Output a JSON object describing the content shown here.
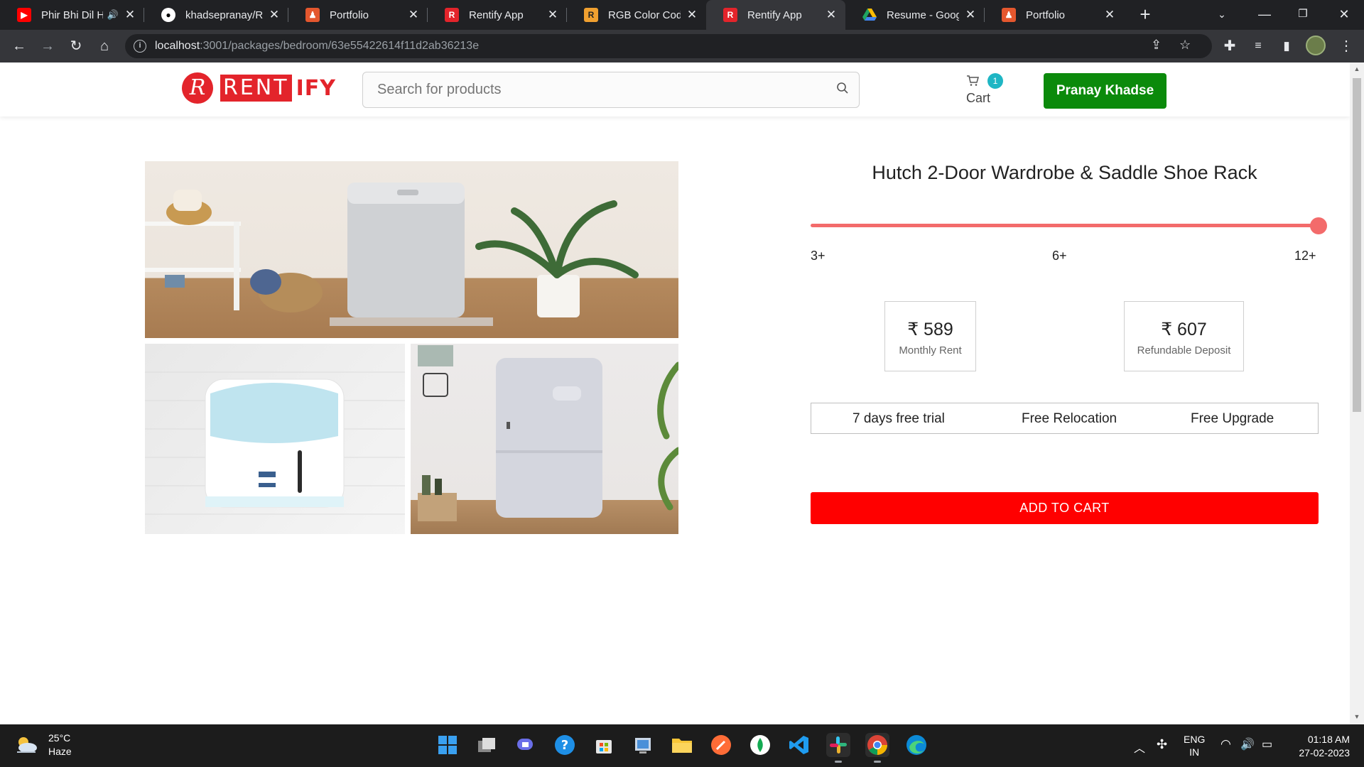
{
  "browser": {
    "tabs": [
      {
        "title": "Phir Bhi Dil H",
        "icon": "youtube-icon",
        "color": "#ff0000",
        "audio": true
      },
      {
        "title": "khadsepranay/Re",
        "icon": "github-icon",
        "color": "#ffffff"
      },
      {
        "title": "Portfolio",
        "icon": "portfolio-icon",
        "color": "#e4572e"
      },
      {
        "title": "Rentify App",
        "icon": "rentify-icon",
        "color": "#e3242b"
      },
      {
        "title": "RGB Color Codes",
        "icon": "rgb-icon",
        "color": "#f0a030"
      },
      {
        "title": "Rentify App",
        "icon": "rentify-icon",
        "color": "#e3242b",
        "active": true
      },
      {
        "title": "Resume - Google",
        "icon": "google-drive-icon",
        "color": "#1fa463"
      },
      {
        "title": "Portfolio",
        "icon": "portfolio-icon",
        "color": "#e4572e"
      }
    ],
    "url_host": "localhost",
    "url_path": ":3001/packages/bedroom/63e55422614f11d2ab36213e"
  },
  "header": {
    "logo_letter": "R",
    "logo_boxed": "RENT",
    "logo_rest": "IFY",
    "search_placeholder": "Search for products",
    "cart_label": "Cart",
    "cart_count": "1",
    "user_name": "Pranay Khadse"
  },
  "product": {
    "title": "Hutch 2-Door Wardrobe & Saddle Shoe Rack",
    "tenure_ticks": [
      "3+",
      "6+",
      "12+"
    ],
    "tenure_selected": "12+",
    "monthly_rent": "₹ 589",
    "monthly_rent_label": "Monthly Rent",
    "deposit": "₹ 607",
    "deposit_label": "Refundable Deposit",
    "features": [
      "7 days free trial",
      "Free Relocation",
      "Free Upgrade"
    ],
    "add_to_cart": "ADD TO CART",
    "images": [
      "washing-machine-image",
      "water-purifier-image",
      "refrigerator-image"
    ]
  },
  "colors": {
    "brand_red": "#e3242b",
    "slider": "#f36b6b",
    "user_button": "#0b8a0b",
    "cart_badge": "#1fb6c4",
    "add_to_cart": "#ff0000"
  },
  "taskbar": {
    "temperature": "25°C",
    "condition": "Haze",
    "lang_top": "ENG",
    "lang_bottom": "IN",
    "time": "01:18 AM",
    "date": "27-02-2023"
  }
}
